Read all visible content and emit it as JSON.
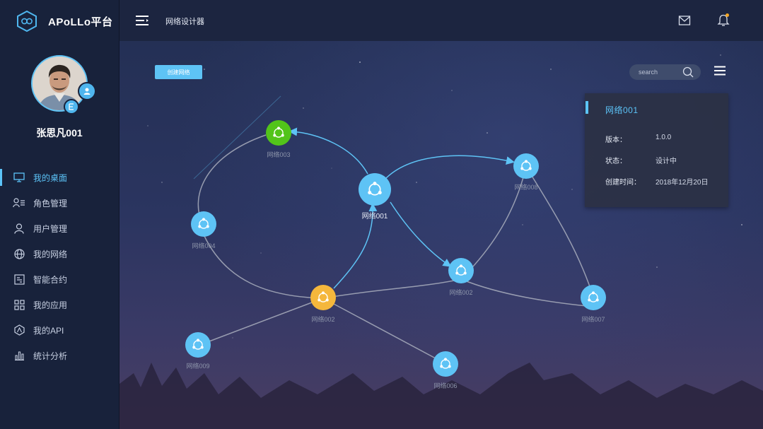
{
  "app": {
    "name": "APoLLo平台"
  },
  "user": {
    "name": "张思凡001"
  },
  "sidebar": {
    "items": [
      {
        "label": "我的桌面",
        "icon": "monitor-icon",
        "active": true
      },
      {
        "label": "角色管理",
        "icon": "role-icon",
        "active": false
      },
      {
        "label": "用户管理",
        "icon": "user-icon",
        "active": false
      },
      {
        "label": "我的网络",
        "icon": "globe-icon",
        "active": false
      },
      {
        "label": "智能合约",
        "icon": "contract-icon",
        "active": false
      },
      {
        "label": "我的应用",
        "icon": "apps-grid-icon",
        "active": false
      },
      {
        "label": "我的API",
        "icon": "api-icon",
        "active": false
      },
      {
        "label": "统计分析",
        "icon": "bar-chart-icon",
        "active": false
      }
    ]
  },
  "header": {
    "title": "网络设计器"
  },
  "toolbar": {
    "create_label": "创建网络",
    "search_placeholder": "search"
  },
  "info": {
    "title": "网络001",
    "rows": [
      {
        "key": "版本：",
        "value": "1.0.0"
      },
      {
        "key": "状态：",
        "value": "设计中"
      },
      {
        "key": "创建时间：",
        "value": "2018年12月20日"
      }
    ]
  },
  "graph": {
    "nodes": [
      {
        "id": "n001",
        "label": "网络001"
      },
      {
        "id": "n003",
        "label": "网络003"
      },
      {
        "id": "n008",
        "label": "网络008"
      },
      {
        "id": "n004",
        "label": "网络004"
      },
      {
        "id": "n002a",
        "label": "网络002"
      },
      {
        "id": "n002b",
        "label": "网络002"
      },
      {
        "id": "n007",
        "label": "网络007"
      },
      {
        "id": "n009",
        "label": "网络009"
      },
      {
        "id": "n006",
        "label": "网络006"
      }
    ]
  },
  "colors": {
    "accent": "#5ec3f5",
    "green": "#52c41a",
    "orange": "#f5b73c",
    "sidebar": "#18223b",
    "header": "#1c2540"
  }
}
